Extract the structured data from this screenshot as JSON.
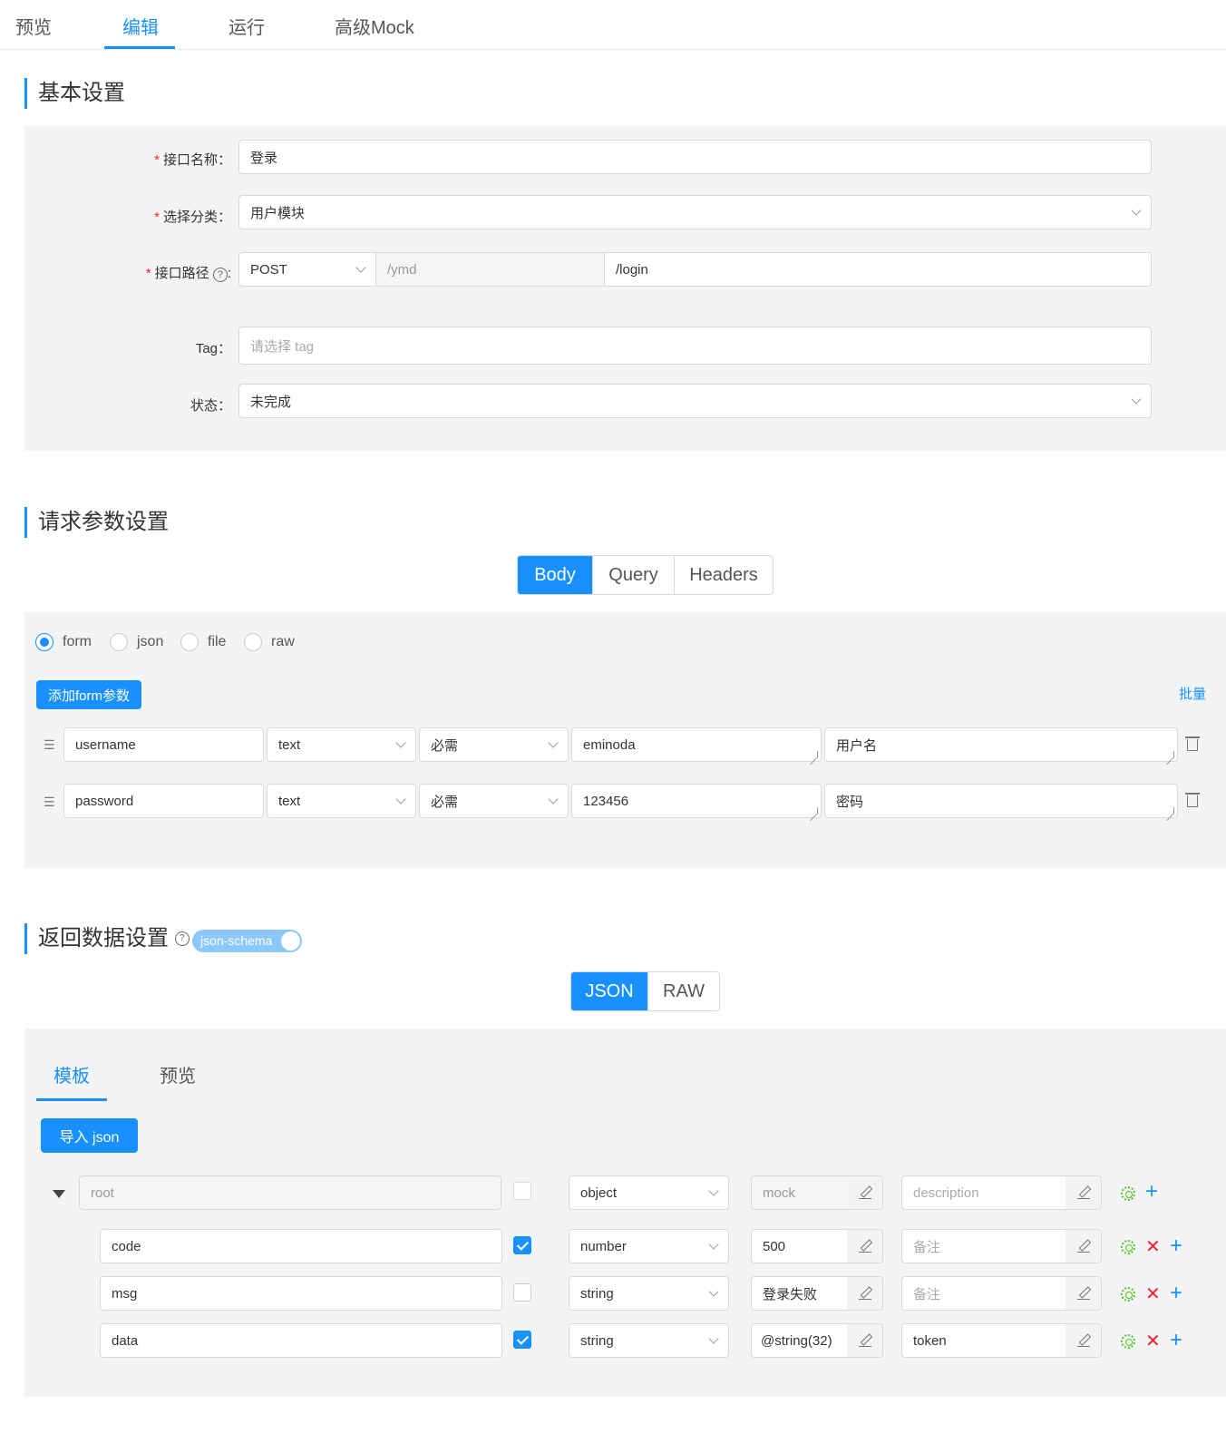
{
  "top_tabs": [
    "预览",
    "编辑",
    "运行",
    "高级Mock"
  ],
  "basic": {
    "title": "基本设置",
    "name_label": "接口名称：",
    "name_value": "登录",
    "category_label": "选择分类：",
    "category_value": "用户模块",
    "path_label": "接口路径",
    "path_help": "?",
    "path_colon": ":",
    "method": "POST",
    "base_path": "/ymd",
    "path_value": "/login",
    "tag_label": "Tag：",
    "tag_placeholder": "请选择 tag",
    "status_label": "状态：",
    "status_value": "未完成",
    "required_mark": "*"
  },
  "request": {
    "title": "请求参数设置",
    "tabs": [
      "Body",
      "Query",
      "Headers"
    ],
    "body_types": [
      "form",
      "json",
      "file",
      "raw"
    ],
    "add_button": "添加form参数",
    "bulk_link": "批量",
    "params": [
      {
        "name": "username",
        "type": "text",
        "required": "必需",
        "example": "eminoda",
        "desc": "用户名"
      },
      {
        "name": "password",
        "type": "text",
        "required": "必需",
        "example": "123456",
        "desc": "密码"
      }
    ]
  },
  "response": {
    "title": "返回数据设置",
    "help": "?",
    "switch_label": "json-schema",
    "tabs": [
      "JSON",
      "RAW"
    ],
    "sub_tabs": [
      "模板",
      "预览"
    ],
    "import_button": "导入 json",
    "root": {
      "name": "root",
      "type": "object",
      "mock": "mock",
      "desc": "description"
    },
    "fields": [
      {
        "name": "code",
        "required": true,
        "type": "number",
        "mock": "500",
        "desc": "备注"
      },
      {
        "name": "msg",
        "required": false,
        "type": "string",
        "mock": "登录失败",
        "desc": "备注"
      },
      {
        "name": "data",
        "required": true,
        "type": "string",
        "mock": "@string(32)",
        "desc": "token"
      }
    ]
  },
  "icons": {
    "drag": "drag-handle-icon",
    "trash": "trash-icon",
    "gear": "settings-icon",
    "plus": "plus-icon",
    "close": "close-icon",
    "edit": "edit-icon"
  },
  "colors": {
    "accent": "#1890ff",
    "required": "#f5222d",
    "settings": "#52c41a"
  }
}
